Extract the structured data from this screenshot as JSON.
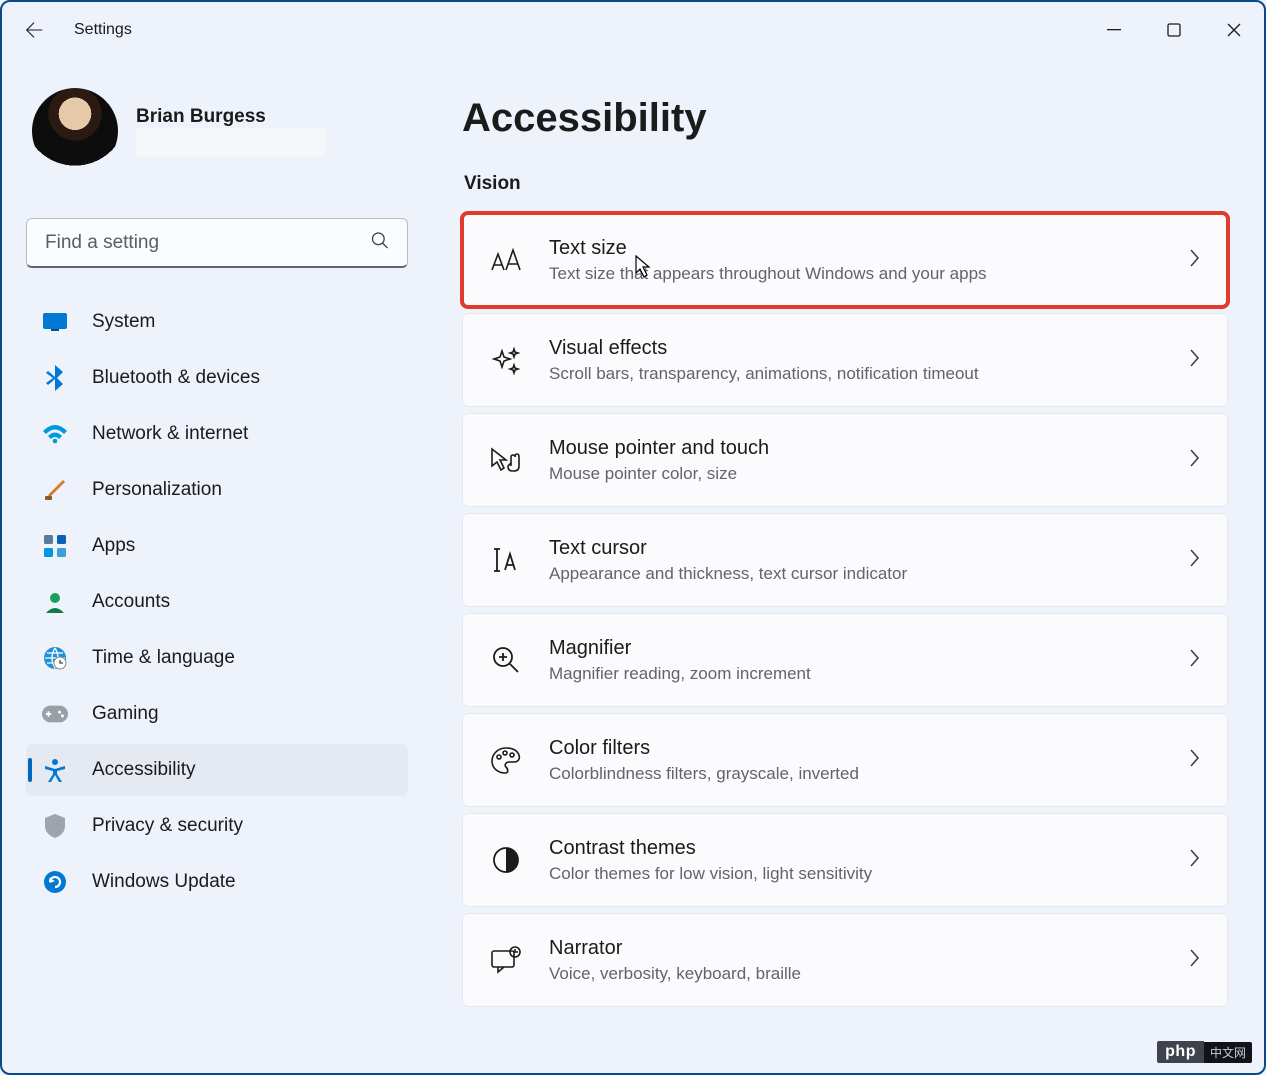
{
  "app_title": "Settings",
  "user": {
    "name": "Brian Burgess"
  },
  "search": {
    "placeholder": "Find a setting"
  },
  "nav": [
    {
      "label": "System",
      "icon": "system"
    },
    {
      "label": "Bluetooth & devices",
      "icon": "bluetooth"
    },
    {
      "label": "Network & internet",
      "icon": "wifi"
    },
    {
      "label": "Personalization",
      "icon": "brush"
    },
    {
      "label": "Apps",
      "icon": "apps"
    },
    {
      "label": "Accounts",
      "icon": "accounts"
    },
    {
      "label": "Time & language",
      "icon": "timelang"
    },
    {
      "label": "Gaming",
      "icon": "gaming"
    },
    {
      "label": "Accessibility",
      "icon": "accessibility",
      "active": true
    },
    {
      "label": "Privacy & security",
      "icon": "privacy"
    },
    {
      "label": "Windows Update",
      "icon": "update"
    }
  ],
  "page": {
    "title": "Accessibility",
    "section": "Vision",
    "items": [
      {
        "title": "Text size",
        "sub": "Text size that appears throughout Windows and your apps",
        "icon": "textsize",
        "highlight": true
      },
      {
        "title": "Visual effects",
        "sub": "Scroll bars, transparency, animations, notification timeout",
        "icon": "sparkle"
      },
      {
        "title": "Mouse pointer and touch",
        "sub": "Mouse pointer color, size",
        "icon": "pointer"
      },
      {
        "title": "Text cursor",
        "sub": "Appearance and thickness, text cursor indicator",
        "icon": "textcursor"
      },
      {
        "title": "Magnifier",
        "sub": "Magnifier reading, zoom increment",
        "icon": "magnifier"
      },
      {
        "title": "Color filters",
        "sub": "Colorblindness filters, grayscale, inverted",
        "icon": "palette"
      },
      {
        "title": "Contrast themes",
        "sub": "Color themes for low vision, light sensitivity",
        "icon": "contrast"
      },
      {
        "title": "Narrator",
        "sub": "Voice, verbosity, keyboard, braille",
        "icon": "narrator"
      }
    ]
  },
  "badge": {
    "a": "php",
    "b": "中文网"
  }
}
